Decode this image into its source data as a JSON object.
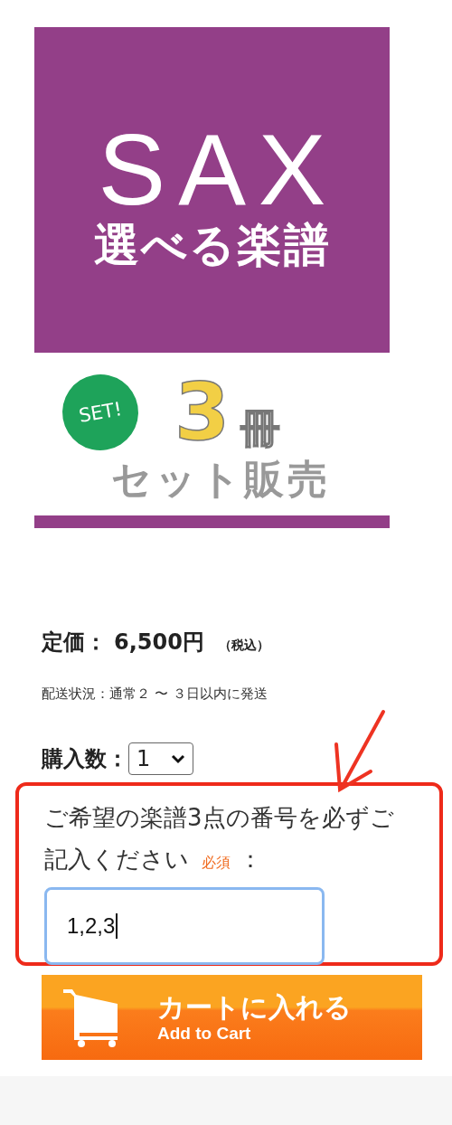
{
  "banner": {
    "title": "SAX",
    "subtitle": "選べる楽譜"
  },
  "set_badge": {
    "badge": "SET!",
    "count": "3",
    "unit": "冊",
    "caption": "セット販売"
  },
  "price": {
    "label": "定価：",
    "value": "6,500円",
    "note": "（税込）"
  },
  "shipping": "配送状況：通常２ 〜 ３日以内に発送",
  "quantity": {
    "label": "購入数：",
    "value": "1"
  },
  "notes_field": {
    "label": "ご希望の楽譜3点の番号を必ずご記入ください",
    "required": "必須",
    "colon": "：",
    "value": "1,2,3",
    "focused": true
  },
  "cart_button": {
    "label": "カートに入れる",
    "sublabel": "Add to Cart"
  }
}
